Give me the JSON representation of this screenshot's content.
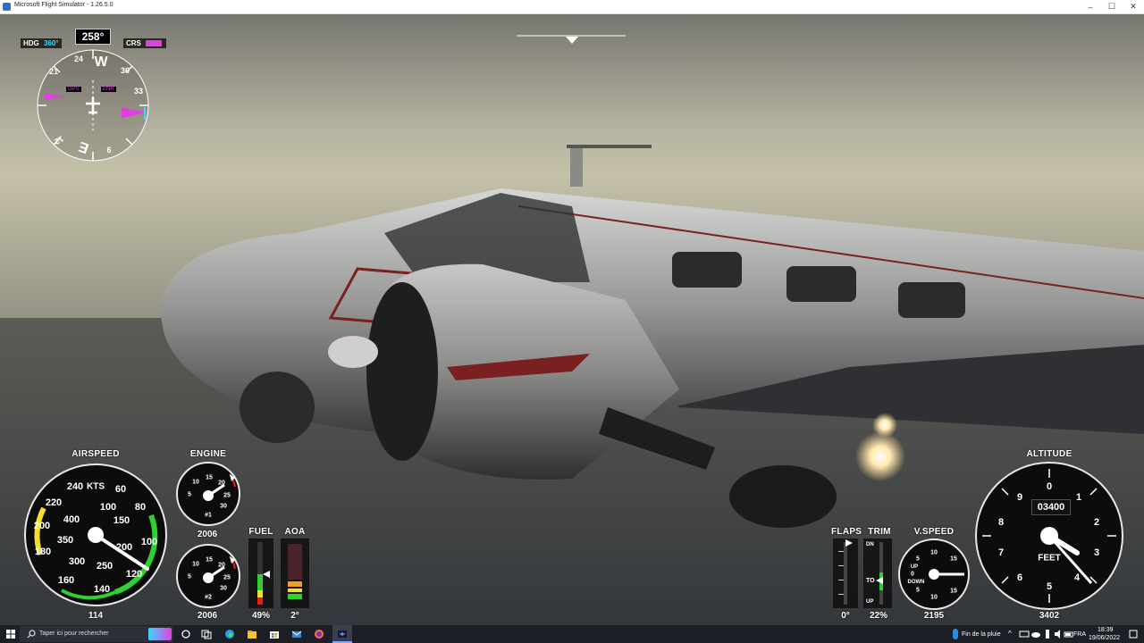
{
  "window": {
    "title": "Microsoft Flight Simulator - 1.26.5.0",
    "minimize": "–",
    "maximize": "☐",
    "close": "✕"
  },
  "hsi": {
    "hdg_label": "HDG",
    "hdg_value": "360°",
    "heading_value": "258°",
    "crs_label": "CRS",
    "gps_label": "GPS",
    "enr_label": "ENR",
    "cardinal": [
      "W",
      "E"
    ],
    "ticks": [
      "24",
      "30",
      "33",
      "21",
      "12",
      "6"
    ]
  },
  "airspeed": {
    "label": "AIRSPEED",
    "unit": "KTS",
    "outer_marks": [
      "240",
      "60",
      "220",
      "80",
      "200",
      "100",
      "180",
      "120",
      "160",
      "140"
    ],
    "inner_marks": [
      "400",
      "100",
      "150",
      "350",
      "200",
      "300",
      "250"
    ],
    "value": "114"
  },
  "engine": {
    "label": "ENGINE",
    "gauge1": {
      "tag": "#1",
      "rpm": "2006",
      "marks": [
        "10",
        "15",
        "20",
        "25",
        "30",
        "5"
      ]
    },
    "gauge2": {
      "tag": "#2",
      "rpm": "2006",
      "marks": [
        "10",
        "15",
        "20",
        "25",
        "30",
        "5"
      ]
    }
  },
  "fuel": {
    "label": "FUEL",
    "value": "49%",
    "level": 0.49
  },
  "aoa": {
    "label": "AOA",
    "value": "2°"
  },
  "flaps": {
    "label": "FLAPS",
    "value": "0°"
  },
  "trim": {
    "label": "TRIM",
    "value": "22%",
    "dn": "DN",
    "to": "TO",
    "up": "UP"
  },
  "vspeed": {
    "label": "V.SPEED",
    "value": "2195",
    "up": "UP",
    "down": "DOWN",
    "marks": [
      "10",
      "5",
      "0",
      "5",
      "10",
      "15",
      "15"
    ]
  },
  "altitude": {
    "label": "ALTITUDE",
    "unit": "FEET",
    "value": "3402",
    "drum": "03400",
    "marks": [
      "0",
      "1",
      "2",
      "3",
      "4",
      "5",
      "6",
      "7",
      "8",
      "9"
    ]
  },
  "taskbar": {
    "search_placeholder": "Taper ici pour rechercher",
    "weather": "Fin de la pluie",
    "lang": "FRA",
    "time": "18:39",
    "date": "19/06/2022"
  },
  "colors": {
    "magenta": "#e040e0",
    "cyan": "#3ad7ff",
    "green": "#2fd12f",
    "yellow": "#f0e030",
    "red": "#e02020"
  }
}
